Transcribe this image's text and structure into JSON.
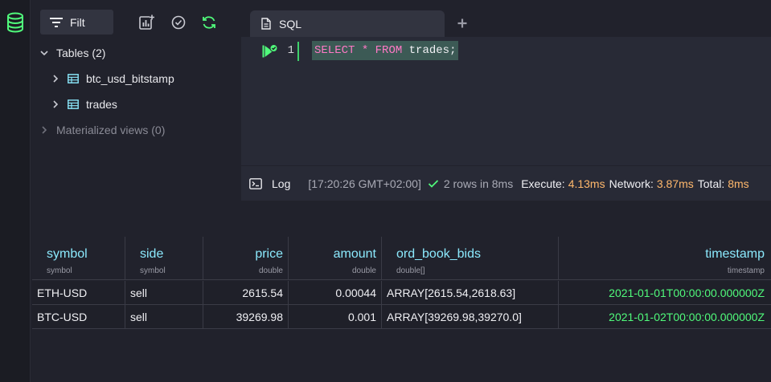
{
  "schema": {
    "filter_label": "Filt",
    "tables_label": "Tables (2)",
    "tables": [
      {
        "name": "btc_usd_bitstamp"
      },
      {
        "name": "trades"
      }
    ],
    "materialized_label": "Materialized views (0)"
  },
  "editor": {
    "tab_label": "SQL",
    "line_number": "1",
    "code": {
      "select": "SELECT",
      "star": "*",
      "from": "FROM",
      "table": "trades",
      "semi": ";"
    }
  },
  "log": {
    "label": "Log",
    "time": "[17:20:26 GMT+02:00]",
    "rows_text": "2 rows in 8ms",
    "execute_label": "Execute:",
    "execute_value": "4.13ms",
    "network_label": "Network:",
    "network_value": "3.87ms",
    "total_label": "Total:",
    "total_value": "8ms"
  },
  "grid": {
    "columns": [
      {
        "name": "symbol",
        "type": "symbol"
      },
      {
        "name": "side",
        "type": "symbol"
      },
      {
        "name": "price",
        "type": "double"
      },
      {
        "name": "amount",
        "type": "double"
      },
      {
        "name": "ord_book_bids",
        "type": "double[]"
      },
      {
        "name": "timestamp",
        "type": "timestamp"
      }
    ],
    "rows": [
      [
        "ETH-USD",
        "sell",
        "2615.54",
        "0.00044",
        "ARRAY[2615.54,2618.63]",
        "2021-01-01T00:00:00.000000Z"
      ],
      [
        "BTC-USD",
        "sell",
        "39269.98",
        "0.001",
        "ARRAY[39269.98,39270.0]",
        "2021-01-02T00:00:00.000000Z"
      ]
    ]
  },
  "colors": {
    "accent_green": "#50fa7b",
    "column_header": "#8be9fd",
    "keyword": "#ff79c6",
    "timing": "#ffb86c"
  },
  "icons": [
    "database-icon",
    "filter-icon",
    "add-chart-icon",
    "check-circle-icon",
    "refresh-icon",
    "chevron-down-icon",
    "chevron-right-icon",
    "table-icon",
    "document-icon",
    "plus-icon",
    "run-icon",
    "terminal-icon",
    "check-icon"
  ]
}
